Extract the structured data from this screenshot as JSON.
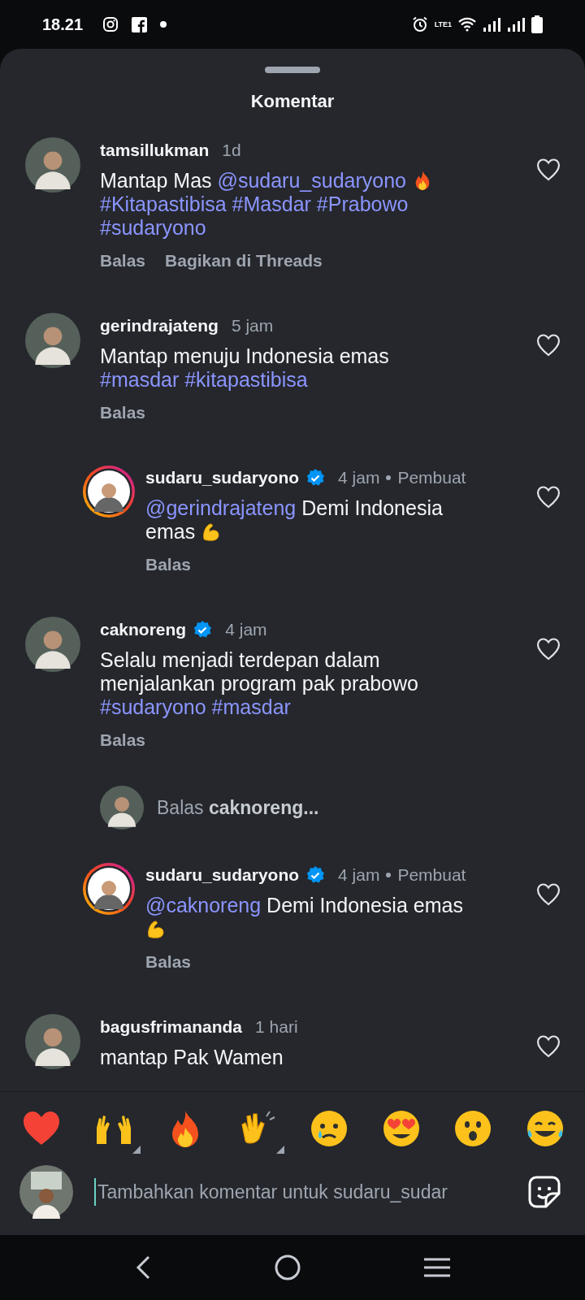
{
  "status_bar": {
    "time": "18.21",
    "network_label": "LTE1"
  },
  "sheet": {
    "title": "Komentar"
  },
  "comments": [
    {
      "kind": "comment",
      "username": "tamsillukman",
      "verified": false,
      "has_story": false,
      "time": "1d",
      "body": [
        {
          "text": "Mantap Mas"
        },
        {
          "text": "@sudaru_sudaryono",
          "kind": "link"
        },
        {
          "kind": "fire"
        },
        {
          "text": "#Kitapastibisa",
          "kind": "link"
        },
        {
          "text": "#Masdar",
          "kind": "link"
        },
        {
          "text": "#Prabowo",
          "kind": "link"
        },
        {
          "text": "#sudaryono",
          "kind": "link"
        }
      ],
      "actions": [
        "Balas",
        "Bagikan di Threads"
      ],
      "liked": false
    },
    {
      "kind": "comment",
      "username": "gerindrajateng",
      "verified": false,
      "has_story": false,
      "time": "5 jam",
      "body": [
        {
          "text": "Mantap menuju Indonesia emas"
        },
        {
          "text": "#masdar",
          "kind": "link"
        },
        {
          "text": "#kitapastibisa",
          "kind": "link"
        }
      ],
      "actions": [
        "Balas"
      ],
      "liked": false
    },
    {
      "kind": "reply",
      "username": "sudaru_sudaryono",
      "verified": true,
      "has_story": true,
      "time": "4 jam",
      "creator_label": "Pembuat",
      "body": [
        {
          "text": "@gerindrajateng",
          "kind": "link"
        },
        {
          "text": "Demi Indonesia emas"
        },
        {
          "kind": "biceps"
        }
      ],
      "actions": [
        "Balas"
      ],
      "liked": false
    },
    {
      "kind": "comment",
      "username": "caknoreng",
      "verified": true,
      "has_story": false,
      "time": "4 jam",
      "body": [
        {
          "text": "Selalu menjadi terdepan dalam menjalankan program pak prabowo"
        },
        {
          "text": "#sudaryono",
          "kind": "link"
        },
        {
          "text": "#masdar",
          "kind": "link"
        }
      ],
      "actions": [
        "Balas"
      ],
      "liked": false
    },
    {
      "kind": "reply_prompt",
      "prompt": "Balas **caknoreng...**"
    },
    {
      "kind": "reply",
      "username": "sudaru_sudaryono",
      "verified": true,
      "has_story": true,
      "time": "4 jam",
      "creator_label": "Pembuat",
      "body": [
        {
          "text": "@caknoreng",
          "kind": "link"
        },
        {
          "text": "Demi Indonesia emas"
        },
        {
          "kind": "biceps"
        }
      ],
      "actions": [
        "Balas"
      ],
      "liked": false
    },
    {
      "kind": "comment",
      "username": "bagusfrimananda",
      "verified": false,
      "has_story": false,
      "time": "1 hari",
      "body": [
        {
          "text": "mantap Pak Wamen"
        }
      ],
      "liked": false
    }
  ],
  "reactions": [
    {
      "kind": "heart",
      "has_variants": false
    },
    {
      "kind": "raised-hands",
      "has_variants": true
    },
    {
      "kind": "fire",
      "has_variants": false
    },
    {
      "kind": "clap",
      "has_variants": true
    },
    {
      "kind": "cry",
      "has_variants": false
    },
    {
      "kind": "heart-eyes",
      "has_variants": false
    },
    {
      "kind": "wow",
      "has_variants": false
    },
    {
      "kind": "joy",
      "has_variants": false
    }
  ],
  "composer": {
    "placeholder": "Tambahkan komentar untuk sudaru_sudar"
  }
}
